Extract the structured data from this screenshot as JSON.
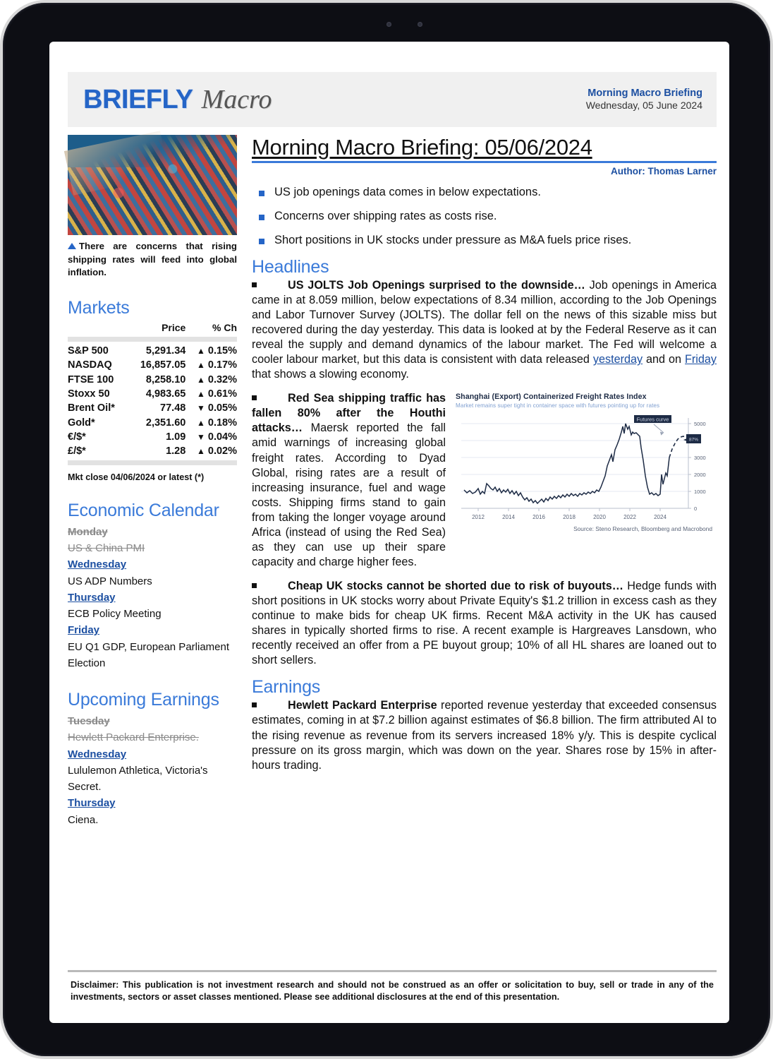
{
  "masthead": {
    "logo_primary": "BRIEFLY",
    "logo_secondary": "Macro",
    "title": "Morning Macro Briefing",
    "date": "Wednesday, 05 June 2024"
  },
  "photo": {
    "caption": "There are concerns that rising shipping rates will feed into global inflation."
  },
  "markets": {
    "heading": "Markets",
    "columns": [
      "",
      "Price",
      "% Ch"
    ],
    "rows": [
      {
        "name": "S&P 500",
        "price": "5,291.34",
        "dir": "up",
        "arrow": "▲",
        "change": "0.15%"
      },
      {
        "name": "NASDAQ",
        "price": "16,857.05",
        "dir": "up",
        "arrow": "▲",
        "change": "0.17%"
      },
      {
        "name": "FTSE 100",
        "price": "8,258.10",
        "dir": "up",
        "arrow": "▲",
        "change": "0.32%"
      },
      {
        "name": "Stoxx 50",
        "price": "4,983.65",
        "dir": "up",
        "arrow": "▲",
        "change": "0.61%"
      },
      {
        "name": "Brent Oil*",
        "price": "77.48",
        "dir": "down",
        "arrow": "▼",
        "change": "0.05%"
      },
      {
        "name": "Gold*",
        "price": "2,351.60",
        "dir": "up",
        "arrow": "▲",
        "change": "0.18%"
      },
      {
        "name": "€/$*",
        "price": "1.09",
        "dir": "down",
        "arrow": "▼",
        "change": "0.04%"
      },
      {
        "name": "£/$*",
        "price": "1.28",
        "dir": "up",
        "arrow": "▲",
        "change": "0.02%"
      }
    ],
    "note": "Mkt close 04/06/2024 or latest (*)",
    "up_color": "#12b512",
    "down_color": "#ee2222"
  },
  "economic_calendar": {
    "heading": "Economic Calendar",
    "entries": [
      {
        "day": "Monday",
        "item": "US & China PMI",
        "past": true
      },
      {
        "day": "Wednesday",
        "item": "US ADP Numbers",
        "past": false
      },
      {
        "day": "Thursday",
        "item": "ECB Policy Meeting",
        "past": false
      },
      {
        "day": "Friday",
        "item": "EU Q1 GDP, European Parliament Election",
        "past": false
      }
    ]
  },
  "upcoming_earnings": {
    "heading": "Upcoming Earnings",
    "entries": [
      {
        "day": "Tuesday",
        "item": "Hewlett Packard Enterprise.",
        "past": true
      },
      {
        "day": "Wednesday",
        "item": "Lululemon Athletica, Victoria's Secret.",
        "past": false
      },
      {
        "day": "Thursday",
        "item": "Ciena.",
        "past": false
      }
    ]
  },
  "document": {
    "title": "Morning Macro Briefing: 05/06/2024",
    "author": "Author: Thomas Larner",
    "key_points": [
      "US job openings data comes in below expectations.",
      "Concerns over shipping rates as costs rise.",
      "Short positions in UK stocks under pressure as M&A fuels price rises."
    ]
  },
  "headlines": {
    "heading": "Headlines",
    "story1": {
      "lead": "US JOLTS Job Openings surprised to the downside…",
      "body_a": " Job openings in America came in at 8.059 million, below expectations of 8.34 million, according to the Job Openings and Labor Turnover Survey (JOLTS). The dollar fell on the news of this sizable miss but recovered during the day yesterday. This data is looked at by the Federal Reserve as it can reveal the supply and demand dynamics of the labour market. The Fed will welcome a cooler labour market, but this data is consistent with data released ",
      "link1": "yesterday",
      "body_b": " and on ",
      "link2": "Friday",
      "body_c": " that shows a slowing economy."
    },
    "story2": {
      "lead": "Red Sea shipping traffic has fallen 80% after the Houthi attacks…",
      "body": " Maersk reported the fall amid warnings of increasing global freight rates. According to Dyad Global, rising rates are a result of increasing insurance, fuel and wage costs. Shipping firms stand to gain from taking the longer voyage around Africa (instead of using the Red Sea) as they can use up their spare capacity and charge higher fees."
    },
    "story3": {
      "lead": "Cheap UK stocks cannot be shorted due to risk of buyouts…",
      "body": " Hedge funds with short positions in UK stocks worry about Private Equity's $1.2 trillion in excess cash as they continue to make bids for cheap UK firms. Recent M&A activity in the UK has caused shares in typically shorted firms to rise. A recent example is Hargreaves Lansdown, who recently received an offer from a PE buyout group; 10% of all HL shares are loaned out to short sellers."
    }
  },
  "earnings": {
    "heading": "Earnings",
    "story": {
      "lead": "Hewlett Packard Enterprise",
      "body": " reported revenue yesterday that exceeded consensus estimates, coming in at $7.2 billion against estimates of $6.8 billion. The firm attributed AI to the rising revenue as revenue from its servers increased 18% y/y. This is despite cyclical pressure on its gross margin, which was down on the year. Shares rose by 15% in after-hours trading."
    }
  },
  "footer": {
    "disclaimer": "Disclaimer: This publication is not investment research and should not be construed as an offer or solicitation to buy, sell or trade in any of the investments, sectors or asset classes mentioned. Please see additional disclosures at the end of this presentation."
  },
  "chart_data": {
    "type": "line",
    "title": "Shanghai (Export) Containerized Freight Rates Index",
    "subtitle": "Market remains super tight in container space with futures pointing up for rates",
    "source": "Source: Steno Research, Bloomberg and Macrobond",
    "xlabel": "",
    "ylabel": "",
    "ylim": [
      0,
      5600
    ],
    "yticks": [
      0,
      1000,
      2000,
      3000,
      5000
    ],
    "xticks": [
      "2012",
      "2014",
      "2016",
      "2018",
      "2020",
      "2022",
      "2024"
    ],
    "xlim": [
      2011,
      2026
    ],
    "grid": true,
    "legend_position": "none",
    "annotations": [
      {
        "label": "Futures curve",
        "style": "dark-badge"
      },
      {
        "label": "87%",
        "style": "dark-badge-right"
      }
    ],
    "series": [
      {
        "name": "SCFI spot",
        "style": "solid",
        "color": "#1d2b45",
        "x": [
          2011.3,
          2011.6,
          2011.9,
          2012.1,
          2012.4,
          2012.7,
          2013.0,
          2013.3,
          2013.6,
          2013.9,
          2014.2,
          2014.5,
          2014.8,
          2015.1,
          2015.4,
          2015.7,
          2016.0,
          2016.3,
          2016.6,
          2016.9,
          2017.2,
          2017.5,
          2017.8,
          2018.1,
          2018.4,
          2018.7,
          2019.0,
          2019.3,
          2019.6,
          2019.9,
          2020.2,
          2020.5,
          2020.8,
          2021.0,
          2021.2,
          2021.4,
          2021.6,
          2021.8,
          2022.0,
          2022.15,
          2022.3,
          2022.5,
          2022.7,
          2022.9,
          2023.1,
          2023.3,
          2023.6,
          2023.9,
          2024.0,
          2024.15,
          2024.3,
          2024.45
        ],
        "y": [
          1100,
          980,
          1020,
          1180,
          1040,
          1090,
          1000,
          980,
          960,
          1010,
          1020,
          960,
          900,
          820,
          700,
          760,
          660,
          720,
          800,
          860,
          920,
          880,
          840,
          900,
          880,
          920,
          880,
          900,
          960,
          1000,
          980,
          1500,
          2600,
          3100,
          4200,
          4600,
          5050,
          4700,
          5100,
          4500,
          4450,
          4400,
          3200,
          1800,
          1100,
          1000,
          1050,
          1000,
          1950,
          1400,
          1900,
          3050
        ]
      },
      {
        "name": "Futures curve",
        "style": "dashed",
        "color": "#1d2b45",
        "x": [
          2024.45,
          2024.7,
          2024.95,
          2025.2,
          2025.5,
          2025.8,
          2026.0
        ],
        "y": [
          3050,
          3900,
          4180,
          4220,
          4150,
          3980,
          3900
        ]
      }
    ]
  }
}
